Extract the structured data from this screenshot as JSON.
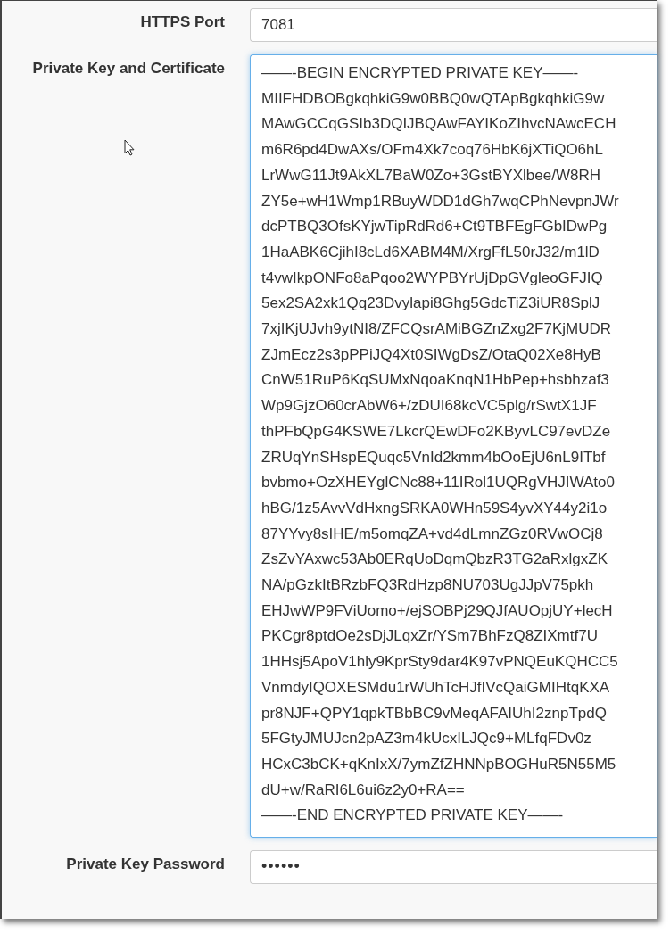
{
  "fields": [
    {
      "kind": "text",
      "label": "HTTPS Port",
      "value": "7081",
      "focused": false
    },
    {
      "kind": "multiline",
      "label": "Private Key and Certificate",
      "focused": true,
      "lines": [
        "——-BEGIN ENCRYPTED PRIVATE KEY——-",
        "MIIFHDBOBgkqhkiG9w0BBQ0wQTApBgkqhkiG9w",
        "MAwGCCqGSIb3DQIJBQAwFAYIKoZIhvcNAwcECH",
        "m6R6pd4DwAXs/OFm4Xk7coq76HbK6jXTiQO6hL",
        "LrWwG11Jt9AkXL7BaW0Zo+3GstBYXlbee/W8RH",
        "ZY5e+wH1Wmp1RBuyWDD1dGh7wqCPhNevpnJWr",
        "dcPTBQ3OfsKYjwTipRdRd6+Ct9TBFEgFGbIDwPg",
        "1HaABK6CjihI8cLd6XABM4M/XrgFfL50rJ32/m1lD",
        "t4vwIkpONFo8aPqoo2WYPBYrUjDpGVgleoGFJIQ",
        "5ex2SA2xk1Qq23Dvylapi8Ghg5GdcTiZ3iUR8SplJ",
        "7xjIKjUJvh9ytNI8/ZFCQsrAMiBGZnZxg2F7KjMUDR",
        "ZJmEcz2s3pPPiJQ4Xt0SIWgDsZ/OtaQ02Xe8HyB",
        "CnW51RuP6KqSUMxNqoaKnqN1HbPep+hsbhzaf3",
        "Wp9GjzO60crAbW6+/zDUI68kcVC5plg/rSwtX1JF",
        "thPFbQpG4KSWE7LkcrQEwDFo2KByvLC97evDZe",
        "ZRUqYnSHspEQuqc5VnId2kmm4bOoEjU6nL9ITbf",
        "bvbmo+OzXHEYglCNc88+11IRol1UQRgVHJIWAto0",
        "hBG/1z5AvvVdHxngSRKA0WHn59S4yvXY44y2i1o",
        "87YYvy8sIHE/m5omqZA+vd4dLmnZGz0RVwOCj8",
        "ZsZvYAxwc53Ab0ERqUoDqmQbzR3TG2aRxlgxZK",
        "NA/pGzkItBRzbFQ3RdHzp8NU703UgJJpV75pkh",
        "EHJwWP9FViUomo+/ejSOBPj29QJfAUOpjUY+lecH",
        "PKCgr8ptdOe2sDjJLqxZr/YSm7BhFzQ8ZIXmtf7U",
        "1HHsj5ApoV1hly9KprSty9dar4K97vPNQEuKQHCC5",
        "VnmdyIQOXESMdu1rWUhTcHJfIVcQaiGMIHtqKXA",
        "pr8NJF+QPY1qpkTBbBC9vMeqAFAIUhI2znpTpdQ",
        "5FGtyJMUJcn2pAZ3m4kUcxILJQc9+MLfqFDv0z",
        "HCxC3bCK+qKnIxX/7ymZfZHNNpBOGHuR5N55M5",
        "dU+w/RaRI6L6ui6z2y0+RA==",
        "——-END ENCRYPTED PRIVATE KEY——-"
      ]
    },
    {
      "kind": "password",
      "label": "Private Key Password",
      "value": "••••••",
      "focused": false
    }
  ]
}
